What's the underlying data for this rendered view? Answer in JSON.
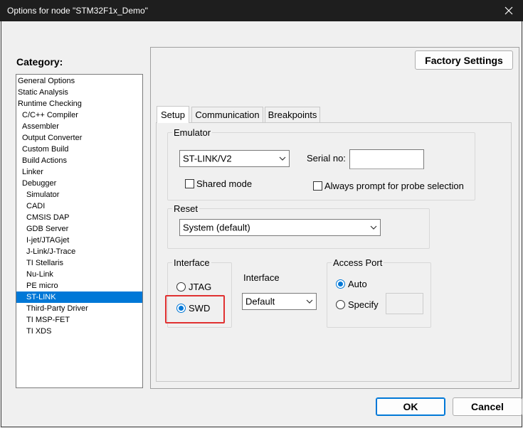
{
  "window": {
    "title": "Options for node \"STM32F1x_Demo\"",
    "close_icon": "close-icon"
  },
  "category": {
    "label": "Category:",
    "items": [
      {
        "label": "General Options",
        "level": 0
      },
      {
        "label": "Static Analysis",
        "level": 0
      },
      {
        "label": "Runtime Checking",
        "level": 0
      },
      {
        "label": "C/C++ Compiler",
        "level": 1
      },
      {
        "label": "Assembler",
        "level": 1
      },
      {
        "label": "Output Converter",
        "level": 1
      },
      {
        "label": "Custom Build",
        "level": 1
      },
      {
        "label": "Build Actions",
        "level": 1
      },
      {
        "label": "Linker",
        "level": 1
      },
      {
        "label": "Debugger",
        "level": 1
      },
      {
        "label": "Simulator",
        "level": 2
      },
      {
        "label": "CADI",
        "level": 2
      },
      {
        "label": "CMSIS DAP",
        "level": 2
      },
      {
        "label": "GDB Server",
        "level": 2
      },
      {
        "label": "I-jet/JTAGjet",
        "level": 2
      },
      {
        "label": "J-Link/J-Trace",
        "level": 2
      },
      {
        "label": "TI Stellaris",
        "level": 2
      },
      {
        "label": "Nu-Link",
        "level": 2
      },
      {
        "label": "PE micro",
        "level": 2
      },
      {
        "label": "ST-LINK",
        "level": 2,
        "selected": true
      },
      {
        "label": "Third-Party Driver",
        "level": 2
      },
      {
        "label": "TI MSP-FET",
        "level": 2
      },
      {
        "label": "TI XDS",
        "level": 2
      }
    ]
  },
  "factory_settings_label": "Factory Settings",
  "tabs": [
    {
      "label": "Setup",
      "active": true
    },
    {
      "label": "Communication",
      "active": false
    },
    {
      "label": "Breakpoints",
      "active": false
    }
  ],
  "emulator": {
    "group_label": "Emulator",
    "selected": "ST-LINK/V2",
    "serial_label": "Serial no:",
    "serial_value": "",
    "shared_mode_label": "Shared mode",
    "shared_mode_checked": false,
    "always_prompt_label": "Always prompt for probe selection",
    "always_prompt_checked": false
  },
  "reset": {
    "group_label": "Reset",
    "selected": "System (default)"
  },
  "interface": {
    "group_label": "Interface",
    "jtag_label": "JTAG",
    "swd_label": "SWD",
    "selected": "SWD",
    "dropdown_label": "Interface",
    "dropdown_selected": "Default"
  },
  "access_port": {
    "group_label": "Access Port",
    "auto_label": "Auto",
    "specify_label": "Specify",
    "selected": "Auto",
    "specify_value": ""
  },
  "buttons": {
    "ok": "OK",
    "cancel": "Cancel"
  },
  "colors": {
    "selection": "#0078d7",
    "highlight_box": "#e03131",
    "titlebar": "#1e1e1e"
  }
}
